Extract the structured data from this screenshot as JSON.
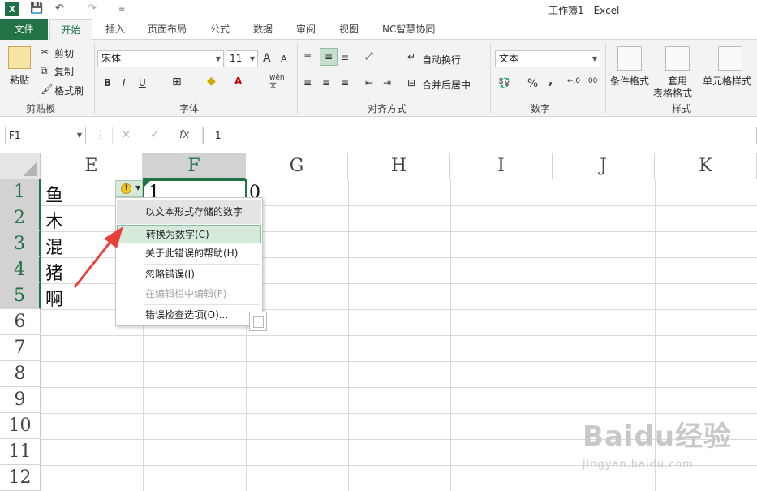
{
  "window": {
    "title": "工作簿1 - Excel",
    "app_icon": "X"
  },
  "quick_access": {
    "save_icon": "💾",
    "undo_icon": "↶",
    "redo_icon": "↷",
    "customize_icon": "="
  },
  "tabs": [
    "文件",
    "开始",
    "插入",
    "页面布局",
    "公式",
    "数据",
    "审阅",
    "视图",
    "NC智慧协同"
  ],
  "ribbon": {
    "clipboard": {
      "paste": "粘贴",
      "cut": "剪切",
      "copy": "复制",
      "format_painter": "格式刷",
      "group": "剪贴板"
    },
    "font": {
      "name": "宋体",
      "size": "11",
      "grow": "A",
      "shrink": "A",
      "bold": "B",
      "italic": "I",
      "underline": "U",
      "wen": "wén",
      "wen_sub": "文",
      "group": "字体"
    },
    "alignment": {
      "wrap": "自动换行",
      "merge": "合并后居中",
      "group": "对齐方式"
    },
    "number": {
      "format": "文本",
      "percent": "%",
      "comma": ",",
      "group": "数字"
    },
    "styles": {
      "conditional": "条件格式",
      "table_format_1": "套用",
      "table_format_2": "表格格式",
      "cell_styles": "单元格样式",
      "group": "样式"
    }
  },
  "formula_bar": {
    "name_box": "F1",
    "cancel": "✕",
    "enter": "✓",
    "fx": "fx",
    "value": "1"
  },
  "columns": [
    "E",
    "F",
    "G",
    "H",
    "I",
    "J",
    "K"
  ],
  "rows": [
    "1",
    "2",
    "3",
    "4",
    "5",
    "6",
    "7",
    "8",
    "9",
    "10",
    "11",
    "12"
  ],
  "cells": {
    "E1": "鱼",
    "E2": "木",
    "E3": "混",
    "E4": "猪",
    "E5": "啊",
    "F1": "1",
    "G1": "0"
  },
  "error_menu": {
    "header": "以文本形式存储的数字",
    "convert": "转换为数字(C)",
    "help": "关于此错误的帮助(H)",
    "ignore": "忽略错误(I)",
    "edit_in_bar": "在编辑栏中编辑(F)",
    "options": "错误检查选项(O)..."
  },
  "watermark": {
    "brand": "Baidu经验",
    "url": "jingyan.baidu.com"
  },
  "colors": {
    "accent": "#217346",
    "highlight": "#d6eadb",
    "arrow": "#e8413b"
  }
}
